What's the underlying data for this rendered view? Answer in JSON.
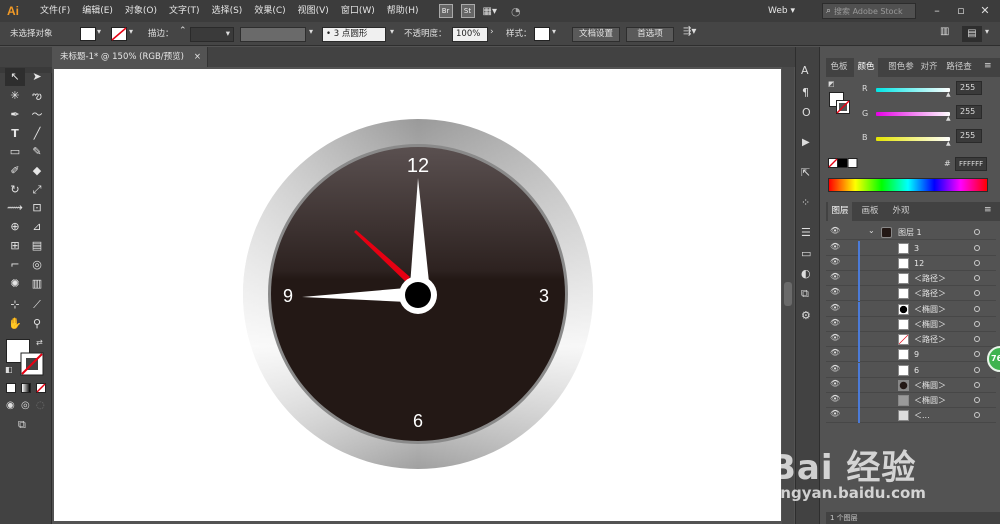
{
  "app": {
    "logo": "Ai",
    "menus": [
      "文件(F)",
      "编辑(E)",
      "对象(O)",
      "文字(T)",
      "选择(S)",
      "效果(C)",
      "视图(V)",
      "窗口(W)",
      "帮助(H)"
    ],
    "badges": [
      "Br",
      "St"
    ],
    "workspace": "Web",
    "search_placeholder": "搜索 Adobe Stock"
  },
  "control_bar": {
    "selection_status": "未选择对象",
    "stroke_label": "描边：",
    "brush_value": "3 点圆形",
    "opacity_label": "不透明度：",
    "opacity_value": "100%",
    "style_label": "样式：",
    "doc_setup_button": "文档设置",
    "prefs_button": "首选项"
  },
  "document": {
    "tab_title": "未标题-1* @ 150% (RGB/预览)",
    "tab_close": "×"
  },
  "artwork": {
    "clock_numbers": [
      "12",
      "3",
      "6",
      "9"
    ],
    "face_color": "#231815",
    "rim_color": "#b5b5b5",
    "second_hand_color": "#e60012"
  },
  "color_panel": {
    "tabs": [
      "色板",
      "颜色",
      "图色参",
      "对齐",
      "路径查"
    ],
    "active_tab": "颜色",
    "channels": [
      {
        "label": "R",
        "value": "255",
        "color": "#00e5e5"
      },
      {
        "label": "G",
        "value": "255",
        "color": "#e500e5"
      },
      {
        "label": "B",
        "value": "255",
        "color": "#e5e500"
      }
    ],
    "hex_label": "#",
    "hex_value": "FFFFFF"
  },
  "layers_panel": {
    "tabs": [
      "图层",
      "画板",
      "外观"
    ],
    "active_tab": "图层",
    "top_layer": "图层 1",
    "items": [
      "3",
      "12",
      "＜路径＞",
      "＜路径＞",
      "＜椭圆＞",
      "＜椭圆＞",
      "＜路径＞",
      "9",
      "6",
      "＜椭圆＞",
      "＜椭圆＞",
      "＜..."
    ],
    "footer": "1 个图层"
  },
  "misc": {
    "badge_percent": "76",
    "watermark_main": "Bai 经验",
    "watermark_url": "jingyan.baidu.com"
  }
}
